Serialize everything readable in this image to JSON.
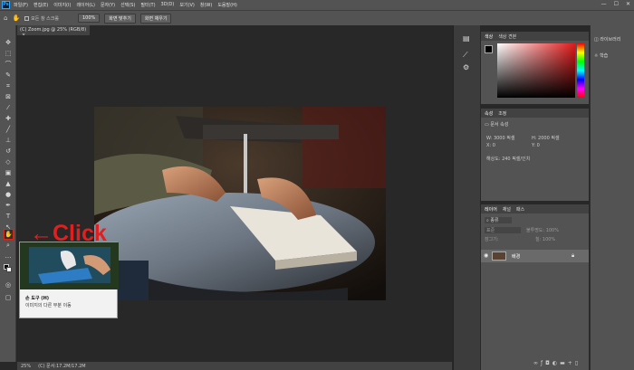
{
  "menubar": {
    "logo": "Ps",
    "items": [
      "파일(F)",
      "편집(E)",
      "이미지(I)",
      "레이어(L)",
      "문자(Y)",
      "선택(S)",
      "필터(T)",
      "3D(D)",
      "보기(V)",
      "창(W)",
      "도움말(H)"
    ],
    "window_controls": [
      "—",
      "☐",
      "✕"
    ]
  },
  "options": {
    "scroll_all_label": "모든 창 스크롤",
    "zoom_value": "100%",
    "fit_screen_label": "화면 맞추기",
    "fill_screen_label": "화면 채우기"
  },
  "document": {
    "tab_title": "(C) Zoom.jpg @ 25% (RGB/8)",
    "tab_close": "×"
  },
  "status": {
    "zoom": "25%",
    "doc_info": "(C) 문서:17.2M/17.2M"
  },
  "color_panel": {
    "tabs": [
      "색상",
      "색상 견본"
    ]
  },
  "properties_panel": {
    "tabs": [
      "속성",
      "조정"
    ],
    "doc_label": "문서 속성",
    "width_label": "W:",
    "width_value": "3000 픽셀",
    "height_label": "H:",
    "height_value": "2000 픽셀",
    "x_label": "X:",
    "x_value": "0",
    "y_label": "Y:",
    "y_value": "0",
    "resolution": "해상도: 240 픽셀/인치"
  },
  "layers_panel": {
    "tabs": [
      "레이어",
      "채널",
      "패스"
    ],
    "kind_label": "종류",
    "blend_mode": "표준",
    "opacity_label": "불투명도:",
    "opacity_value": "100%",
    "lock_label": "잠그기:",
    "fill_label": "칠:",
    "fill_value": "100%",
    "layer_name": "배경"
  },
  "right_strip": {
    "items": [
      "라이브러리",
      "학습"
    ]
  },
  "tooltip": {
    "title": "손 도구 (H)",
    "description": "이미지의 다른 부분 이동"
  },
  "annotation": {
    "arrow": "←",
    "text": "Click",
    "color": "#e02020"
  }
}
